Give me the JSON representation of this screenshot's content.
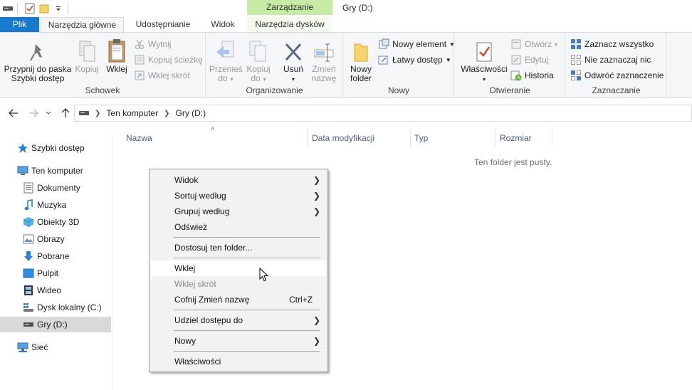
{
  "window": {
    "title": "Gry (D:)",
    "context_tab_group": "Zarządzanie"
  },
  "tabs": [
    {
      "label": "Plik"
    },
    {
      "label": "Narzędzia główne",
      "active": true
    },
    {
      "label": "Udostępnianie"
    },
    {
      "label": "Widok"
    },
    {
      "label": "Narzędzia dysków"
    }
  ],
  "ribbon": {
    "clipboard": {
      "label": "Schowek",
      "pin_line1": "Przypnij do paska",
      "pin_line2": "Szybki dostęp",
      "copy": "Kopiuj",
      "paste": "Wklej",
      "cut": "Wytnij",
      "copy_path": "Kopiuj ścieżkę",
      "paste_shortcut": "Wklej skrót"
    },
    "organize": {
      "label": "Organizowanie",
      "move_line1": "Przenieś",
      "move_line2": "do",
      "copy_line1": "Kopiuj",
      "copy_line2": "do",
      "delete": "Usuń",
      "rename_line1": "Zmień",
      "rename_line2": "nazwę"
    },
    "new": {
      "label": "Nowy",
      "folder_line1": "Nowy",
      "folder_line2": "folder",
      "new_item": "Nowy element",
      "easy_access": "Łatwy dostęp"
    },
    "open": {
      "label": "Otwieranie",
      "properties": "Właściwości",
      "open": "Otwórz",
      "edit": "Edytuj",
      "history": "Historia"
    },
    "select": {
      "label": "Zaznaczanie",
      "select_all": "Zaznacz wszystko",
      "select_none": "Nie zaznaczaj nic",
      "invert": "Odwróć zaznaczenie"
    }
  },
  "address": {
    "crumbs": [
      "Ten komputer",
      "Gry (D:)"
    ]
  },
  "navpane": {
    "quick_access": "Szybki dostęp",
    "this_pc": "Ten komputer",
    "items": [
      "Dokumenty",
      "Muzyka",
      "Obiekty 3D",
      "Obrazy",
      "Pobrane",
      "Pulpit",
      "Wideo",
      "Dysk lokalny (C:)",
      "Gry (D:)"
    ],
    "network": "Sieć"
  },
  "columns": [
    "Nazwa",
    "Data modyfikacji",
    "Typ",
    "Rozmiar"
  ],
  "empty_message": "Ten folder jest pusty.",
  "context_menu": {
    "view": "Widok",
    "sort_by": "Sortuj według",
    "group_by": "Grupuj według",
    "refresh": "Odśwież",
    "customize": "Dostosuj ten folder...",
    "paste": "Wklej",
    "paste_shortcut": "Wklej skrót",
    "undo_rename": "Cofnij Zmień nazwę",
    "undo_shortcut": "Ctrl+Z",
    "give_access": "Udziel dostępu do",
    "new": "Nowy",
    "properties": "Właściwości"
  },
  "colors": {
    "file_tab": "#1979ca",
    "context_tab": "#c7eaa5",
    "ribbon_bg": "#f5f6f7",
    "selection": "#d9d9d9"
  }
}
